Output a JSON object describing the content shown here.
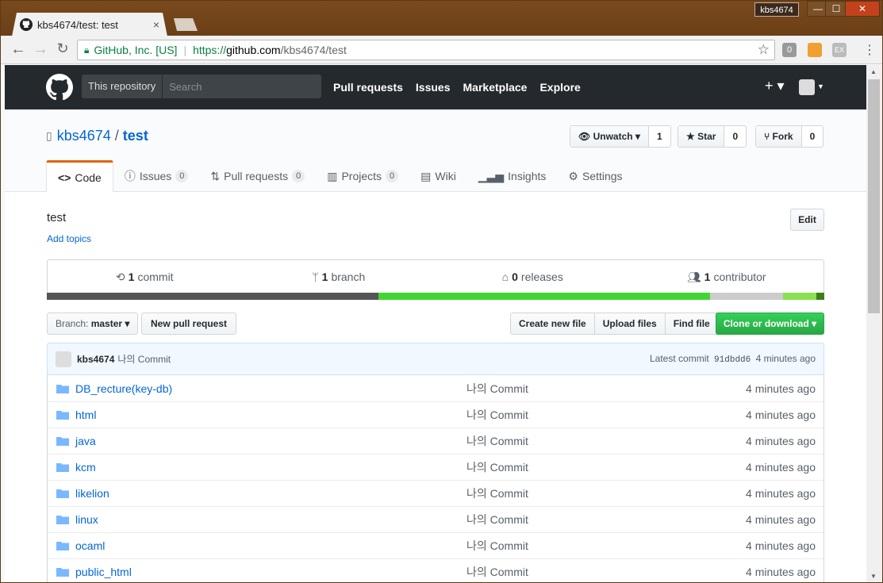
{
  "browser": {
    "tab_title": "kbs4674/test: test",
    "tab_close": "×",
    "user_badge": "kbs4674",
    "win_min": "—",
    "win_max": "☐",
    "win_close": "✕",
    "security_label": "GitHub, Inc. [US]",
    "url_prefix": "https://",
    "url_host": "github.com",
    "url_path": "/kbs4674/test",
    "ext1": "0",
    "ext3": "EX"
  },
  "github_header": {
    "search_scope": "This repository",
    "search_placeholder": "Search",
    "nav": [
      "Pull requests",
      "Issues",
      "Marketplace",
      "Explore"
    ],
    "plus": "+ ▾"
  },
  "repo": {
    "owner": "kbs4674",
    "slash": "/",
    "name": "test",
    "unwatch_label": "Unwatch ▾",
    "unwatch_count": "1",
    "star_label": "Star",
    "star_count": "0",
    "fork_label": "Fork",
    "fork_count": "0",
    "tabs": [
      {
        "label": "Code",
        "icon": "<>"
      },
      {
        "label": "Issues",
        "count": "0"
      },
      {
        "label": "Pull requests",
        "count": "0"
      },
      {
        "label": "Projects",
        "count": "0"
      },
      {
        "label": "Wiki"
      },
      {
        "label": "Insights"
      },
      {
        "label": "Settings"
      }
    ],
    "description": "test",
    "add_topics": "Add topics",
    "edit_label": "Edit"
  },
  "summary": {
    "commits_n": "1",
    "commits_lbl": "commit",
    "branches_n": "1",
    "branches_lbl": "branch",
    "releases_n": "0",
    "releases_lbl": "releases",
    "contributors_n": "1",
    "contributors_lbl": "contributor"
  },
  "language_bar": [
    {
      "color": "#555555",
      "percent": 42.7
    },
    {
      "color": "#41d534",
      "percent": 42.6
    },
    {
      "color": "#cccccc",
      "percent": 9.4
    },
    {
      "color": "#89e051",
      "percent": 4.3
    },
    {
      "color": "#3c7f1a",
      "percent": 1.0
    }
  ],
  "controls": {
    "branch_prefix": "Branch:",
    "branch_name": "master ▾",
    "new_pr": "New pull request",
    "create_file": "Create new file",
    "upload_files": "Upload files",
    "find_file": "Find file",
    "clone": "Clone or download ▾"
  },
  "commit": {
    "user": "kbs4674",
    "message": "나의 Commit",
    "latest_label": "Latest commit",
    "sha": "91dbdd6",
    "age": "4 minutes ago"
  },
  "files": [
    {
      "name": "DB_recture(key-db)",
      "message": "나의 Commit",
      "age": "4 minutes ago"
    },
    {
      "name": "html",
      "message": "나의 Commit",
      "age": "4 minutes ago"
    },
    {
      "name": "java",
      "message": "나의 Commit",
      "age": "4 minutes ago"
    },
    {
      "name": "kcm",
      "message": "나의 Commit",
      "age": "4 minutes ago"
    },
    {
      "name": "likelion",
      "message": "나의 Commit",
      "age": "4 minutes ago"
    },
    {
      "name": "linux",
      "message": "나의 Commit",
      "age": "4 minutes ago"
    },
    {
      "name": "ocaml",
      "message": "나의 Commit",
      "age": "4 minutes ago"
    },
    {
      "name": "public_html",
      "message": "나의 Commit",
      "age": "4 minutes ago"
    }
  ]
}
